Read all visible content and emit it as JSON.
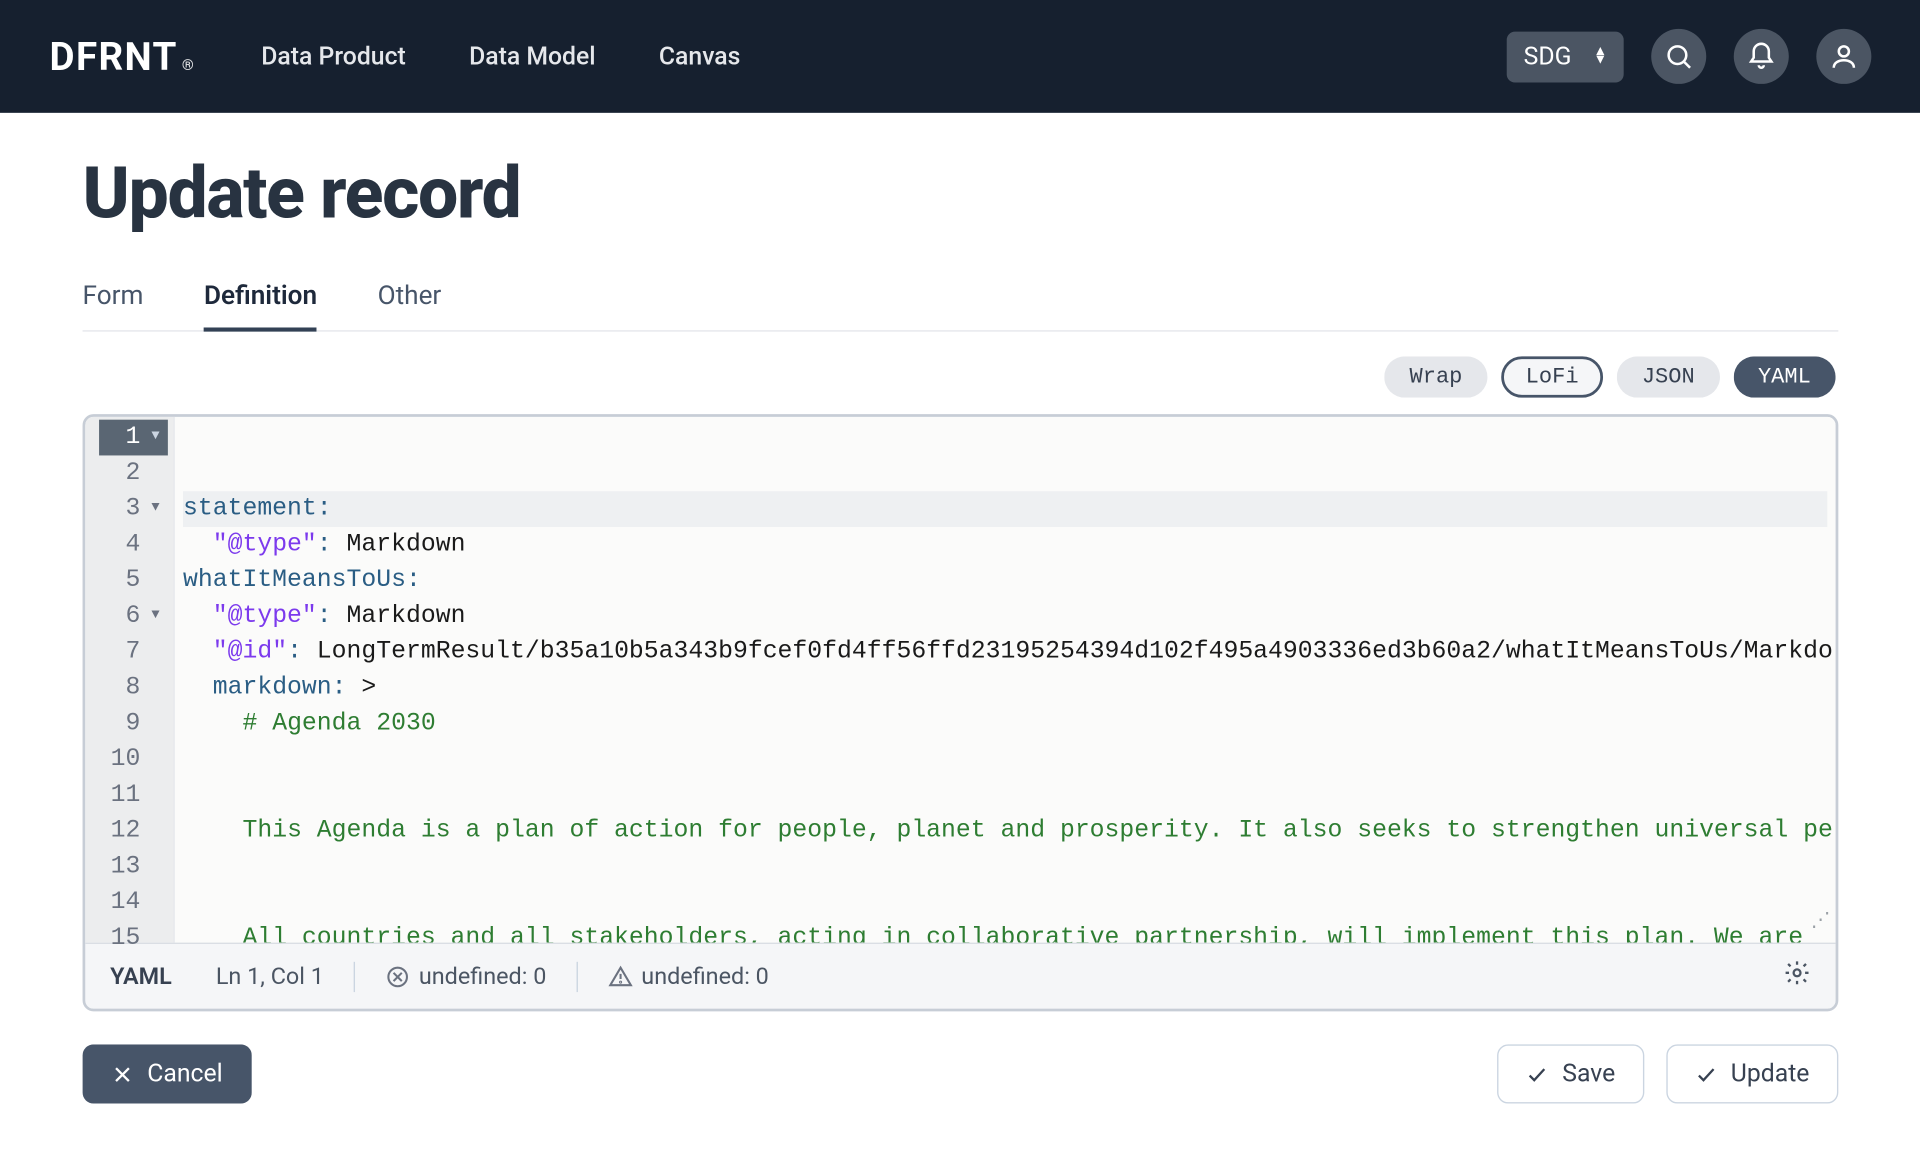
{
  "header": {
    "logo": "DFRNT",
    "logo_reg": "®",
    "nav": [
      "Data Product",
      "Data Model",
      "Canvas"
    ],
    "env_selected": "SDG"
  },
  "page": {
    "title": "Update record",
    "tabs": [
      {
        "label": "Form",
        "active": false
      },
      {
        "label": "Definition",
        "active": true
      },
      {
        "label": "Other",
        "active": false
      }
    ]
  },
  "editor_toolbar": {
    "wrap": "Wrap",
    "lofi": "LoFi",
    "json": "JSON",
    "yaml": "YAML"
  },
  "code": {
    "lines": [
      {
        "n": 1,
        "fold": true,
        "current": true,
        "tokens": [
          [
            "key",
            "statement:"
          ]
        ]
      },
      {
        "n": 2,
        "tokens": [
          [
            "ind",
            "  "
          ],
          [
            "q",
            "\"@type\""
          ],
          [
            "key",
            ": "
          ],
          [
            "plain",
            "Markdown"
          ]
        ]
      },
      {
        "n": 3,
        "fold": true,
        "tokens": [
          [
            "key",
            "whatItMeansToUs:"
          ]
        ]
      },
      {
        "n": 4,
        "tokens": [
          [
            "ind",
            "  "
          ],
          [
            "q",
            "\"@type\""
          ],
          [
            "key",
            ": "
          ],
          [
            "plain",
            "Markdown"
          ]
        ]
      },
      {
        "n": 5,
        "tokens": [
          [
            "ind",
            "  "
          ],
          [
            "q",
            "\"@id\""
          ],
          [
            "key",
            ": "
          ],
          [
            "plain",
            "LongTermResult/b35a10b5a343b9fcef0fd4ff56ffd23195254394d102f495a4903336ed3b60a2/whatItMeansToUs/Markdo"
          ]
        ]
      },
      {
        "n": 6,
        "fold": true,
        "tokens": [
          [
            "ind",
            "  "
          ],
          [
            "key",
            "markdown: "
          ],
          [
            "plain",
            ">"
          ]
        ]
      },
      {
        "n": 7,
        "tokens": [
          [
            "ind",
            "    "
          ],
          [
            "str",
            "# Agenda 2030"
          ]
        ]
      },
      {
        "n": 8,
        "tokens": []
      },
      {
        "n": 9,
        "tokens": []
      },
      {
        "n": 10,
        "tokens": [
          [
            "ind",
            "    "
          ],
          [
            "str",
            "This Agenda is a plan of action for people, planet and prosperity. It also seeks to strengthen universal pe"
          ]
        ]
      },
      {
        "n": 11,
        "tokens": []
      },
      {
        "n": 12,
        "tokens": []
      },
      {
        "n": 13,
        "tokens": [
          [
            "ind",
            "    "
          ],
          [
            "str",
            "All countries and all stakeholders, acting in collaborative partnership, will implement this plan. We are "
          ]
        ]
      },
      {
        "n": 14,
        "tokens": []
      },
      {
        "n": 15,
        "tokens": []
      }
    ]
  },
  "status": {
    "language": "YAML",
    "cursor": "Ln 1, Col 1",
    "errors_label": "undefined: 0",
    "warnings_label": "undefined: 0"
  },
  "footer": {
    "cancel": "Cancel",
    "save": "Save",
    "update": "Update"
  }
}
